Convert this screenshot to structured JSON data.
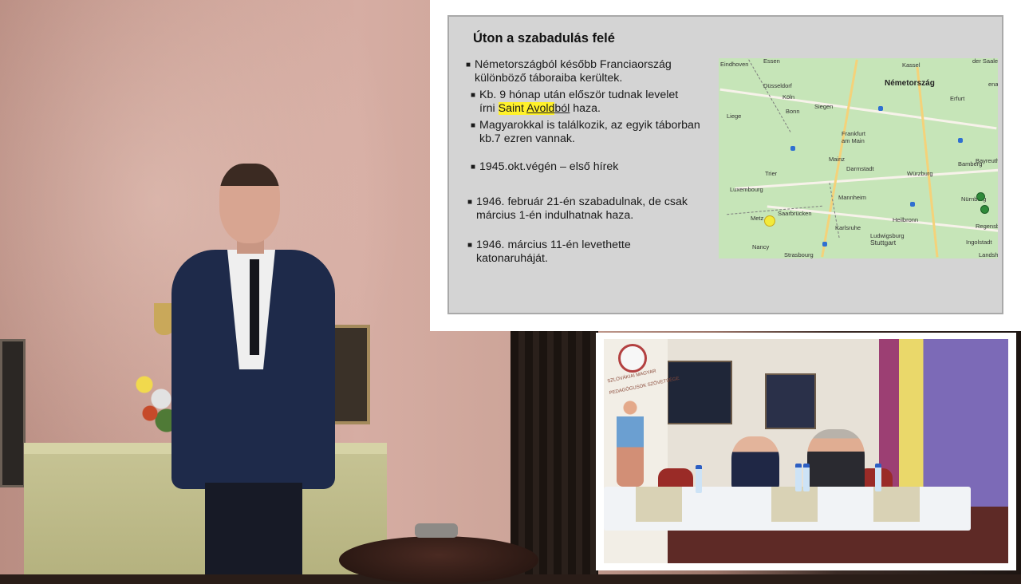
{
  "slide": {
    "title": "Úton a szabadulás felé",
    "bullets": [
      {
        "text": "Németországból később Franciaország különböző táboraiba kerültek."
      },
      {
        "before": "Kb. 9 hónap után először tudnak levelet írni ",
        "highlight_a": "Saint ",
        "highlight_b": "Avold",
        "after_underline": "ból",
        "after": " haza."
      },
      {
        "text": "Magyarokkal is találkozik, az egyik táborban kb.7 ezren vannak."
      },
      {
        "text": "1945.okt.végén – első hírek"
      },
      {
        "text": "1946. február 21-én szabadulnak, de csak március 1-én indulhatnak haza."
      },
      {
        "text": "1946. március 11-én levethette katonaruháját."
      }
    ],
    "highlight_color": "#fff12b"
  },
  "map": {
    "country_label": "Németország",
    "cities": [
      "Eindhoven",
      "Essen",
      "Düsseldorf",
      "Köln",
      "Bonn",
      "Liege",
      "Frankfurt am Main",
      "Mainz",
      "Darmstadt",
      "Würzburg",
      "Bamberg",
      "Bayreuth",
      "Trier",
      "Luxembourg",
      "Saarbrücken",
      "Mannheim",
      "Nürnberg",
      "Metz",
      "Heilbronn",
      "Karlsruhe",
      "Regensburg",
      "Ludwigsburg",
      "Stuttgart",
      "Ingolstadt",
      "Nancy",
      "Strasbourg",
      "Landsh",
      "der Saale",
      "ena",
      "Erfurt",
      "Siegen",
      "Kassel"
    ]
  },
  "inset": {
    "banner_lines": [
      "SZLOVÁKIAI MAGYAR",
      "PEDAGÓGUSOK SZÖVETSÉGE"
    ]
  }
}
